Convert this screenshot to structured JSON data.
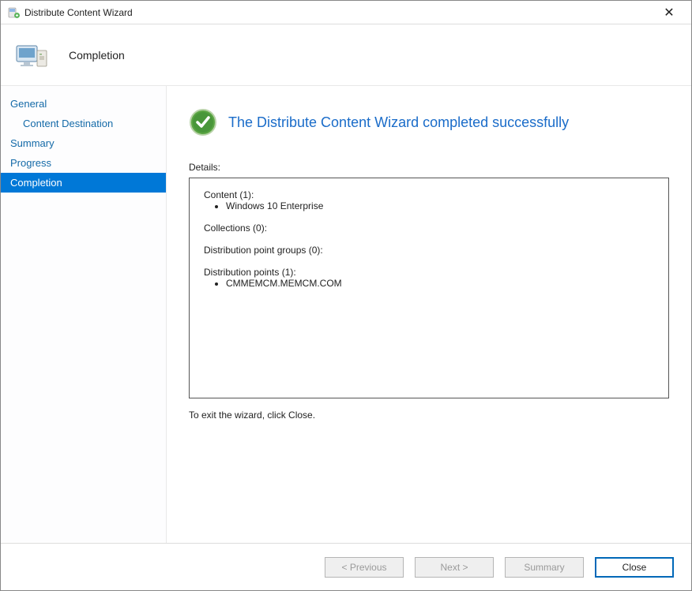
{
  "window": {
    "title": "Distribute Content Wizard"
  },
  "header": {
    "title": "Completion"
  },
  "sidebar": {
    "items": [
      {
        "label": "General",
        "indent": false,
        "selected": false
      },
      {
        "label": "Content Destination",
        "indent": true,
        "selected": false
      },
      {
        "label": "Summary",
        "indent": false,
        "selected": false
      },
      {
        "label": "Progress",
        "indent": false,
        "selected": false
      },
      {
        "label": "Completion",
        "indent": false,
        "selected": true
      }
    ]
  },
  "main": {
    "success_message": "The Distribute Content Wizard completed successfully",
    "details_label": "Details:",
    "details": {
      "content": {
        "title": "Content (1):",
        "items": [
          "Windows 10 Enterprise"
        ]
      },
      "collections": {
        "title": "Collections (0):",
        "items": []
      },
      "dp_groups": {
        "title": "Distribution point groups (0):",
        "items": []
      },
      "dps": {
        "title": "Distribution points (1):",
        "items": [
          "CMMEMCM.MEMCM.COM"
        ]
      }
    },
    "exit_hint": "To exit the wizard, click Close."
  },
  "footer": {
    "previous": "< Previous",
    "next": "Next >",
    "summary": "Summary",
    "close": "Close"
  }
}
